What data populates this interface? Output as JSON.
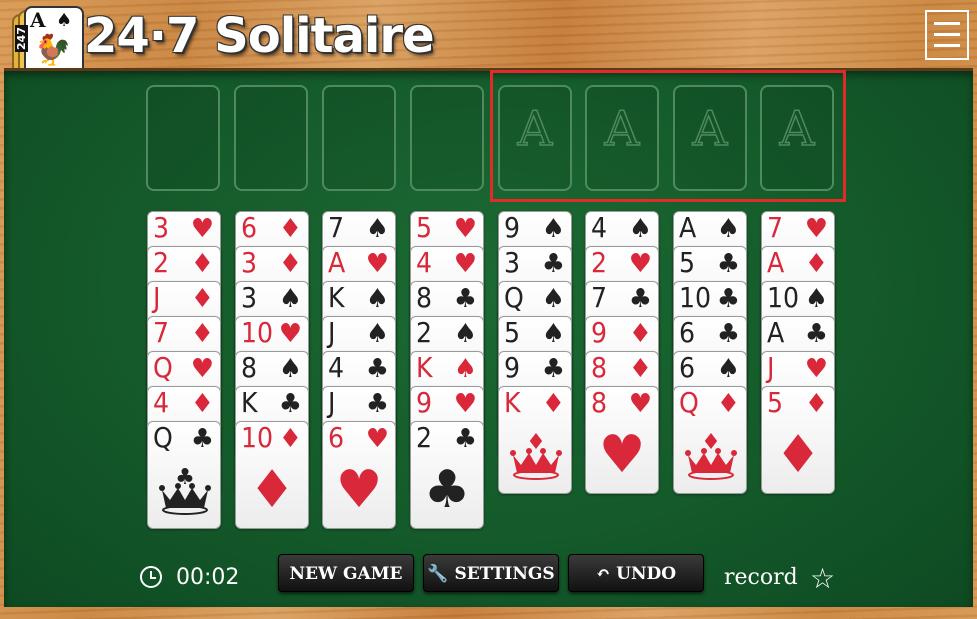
{
  "header": {
    "title": "24·7 Solitaire",
    "logo_text": "247",
    "logo_card_rank": "A",
    "menu_icon": "hamburger-icon"
  },
  "free_cells": [
    {
      "label": ""
    },
    {
      "label": ""
    },
    {
      "label": ""
    },
    {
      "label": ""
    }
  ],
  "foundations": [
    {
      "label": "A"
    },
    {
      "label": "A"
    },
    {
      "label": "A"
    },
    {
      "label": "A"
    }
  ],
  "tableau": [
    [
      {
        "rank": "3",
        "suit": "♥",
        "color": "red"
      },
      {
        "rank": "2",
        "suit": "♦",
        "color": "red"
      },
      {
        "rank": "J",
        "suit": "♦",
        "color": "red"
      },
      {
        "rank": "7",
        "suit": "♦",
        "color": "red"
      },
      {
        "rank": "Q",
        "suit": "♥",
        "color": "red"
      },
      {
        "rank": "4",
        "suit": "♦",
        "color": "red"
      },
      {
        "rank": "Q",
        "suit": "♣",
        "color": "black",
        "face": "crown"
      }
    ],
    [
      {
        "rank": "6",
        "suit": "♦",
        "color": "red"
      },
      {
        "rank": "3",
        "suit": "♦",
        "color": "red"
      },
      {
        "rank": "3",
        "suit": "♠",
        "color": "black"
      },
      {
        "rank": "10",
        "suit": "♥",
        "color": "red"
      },
      {
        "rank": "8",
        "suit": "♠",
        "color": "black"
      },
      {
        "rank": "K",
        "suit": "♣",
        "color": "black"
      },
      {
        "rank": "10",
        "suit": "♦",
        "color": "red",
        "face": "pip"
      }
    ],
    [
      {
        "rank": "7",
        "suit": "♠",
        "color": "black"
      },
      {
        "rank": "A",
        "suit": "♥",
        "color": "red"
      },
      {
        "rank": "K",
        "suit": "♠",
        "color": "black"
      },
      {
        "rank": "J",
        "suit": "♠",
        "color": "black"
      },
      {
        "rank": "4",
        "suit": "♣",
        "color": "black"
      },
      {
        "rank": "J",
        "suit": "♣",
        "color": "black"
      },
      {
        "rank": "6",
        "suit": "♥",
        "color": "red",
        "face": "pip"
      }
    ],
    [
      {
        "rank": "5",
        "suit": "♥",
        "color": "red"
      },
      {
        "rank": "4",
        "suit": "♥",
        "color": "red"
      },
      {
        "rank": "8",
        "suit": "♣",
        "color": "black"
      },
      {
        "rank": "2",
        "suit": "♠",
        "color": "black"
      },
      {
        "rank": "K",
        "suit": "♠",
        "color": "red"
      },
      {
        "rank": "9",
        "suit": "♥",
        "color": "red"
      },
      {
        "rank": "2",
        "suit": "♣",
        "color": "black",
        "face": "pip"
      }
    ],
    [
      {
        "rank": "9",
        "suit": "♠",
        "color": "black"
      },
      {
        "rank": "3",
        "suit": "♣",
        "color": "black"
      },
      {
        "rank": "Q",
        "suit": "♠",
        "color": "black"
      },
      {
        "rank": "5",
        "suit": "♠",
        "color": "black"
      },
      {
        "rank": "9",
        "suit": "♣",
        "color": "black"
      },
      {
        "rank": "K",
        "suit": "♦",
        "color": "red",
        "face": "crown"
      }
    ],
    [
      {
        "rank": "4",
        "suit": "♠",
        "color": "black"
      },
      {
        "rank": "2",
        "suit": "♥",
        "color": "red"
      },
      {
        "rank": "7",
        "suit": "♣",
        "color": "black"
      },
      {
        "rank": "9",
        "suit": "♦",
        "color": "red"
      },
      {
        "rank": "8",
        "suit": "♦",
        "color": "red"
      },
      {
        "rank": "8",
        "suit": "♥",
        "color": "red",
        "face": "pip"
      }
    ],
    [
      {
        "rank": "A",
        "suit": "♠",
        "color": "black"
      },
      {
        "rank": "5",
        "suit": "♣",
        "color": "black"
      },
      {
        "rank": "10",
        "suit": "♣",
        "color": "black"
      },
      {
        "rank": "6",
        "suit": "♣",
        "color": "black"
      },
      {
        "rank": "6",
        "suit": "♠",
        "color": "black"
      },
      {
        "rank": "Q",
        "suit": "♦",
        "color": "red",
        "face": "crown"
      }
    ],
    [
      {
        "rank": "7",
        "suit": "♥",
        "color": "red"
      },
      {
        "rank": "A",
        "suit": "♦",
        "color": "red"
      },
      {
        "rank": "10",
        "suit": "♠",
        "color": "black"
      },
      {
        "rank": "A",
        "suit": "♣",
        "color": "black"
      },
      {
        "rank": "J",
        "suit": "♥",
        "color": "red"
      },
      {
        "rank": "5",
        "suit": "♦",
        "color": "red",
        "face": "pip"
      }
    ]
  ],
  "footer": {
    "timer": "00:02",
    "new_game": "NEW GAME",
    "settings": "SETTINGS",
    "undo": "UNDO",
    "record": "record"
  },
  "colors": {
    "felt": "#145a2a",
    "red_suit": "#d8283a",
    "black_suit": "#222222",
    "highlight": "#e02b2b"
  }
}
